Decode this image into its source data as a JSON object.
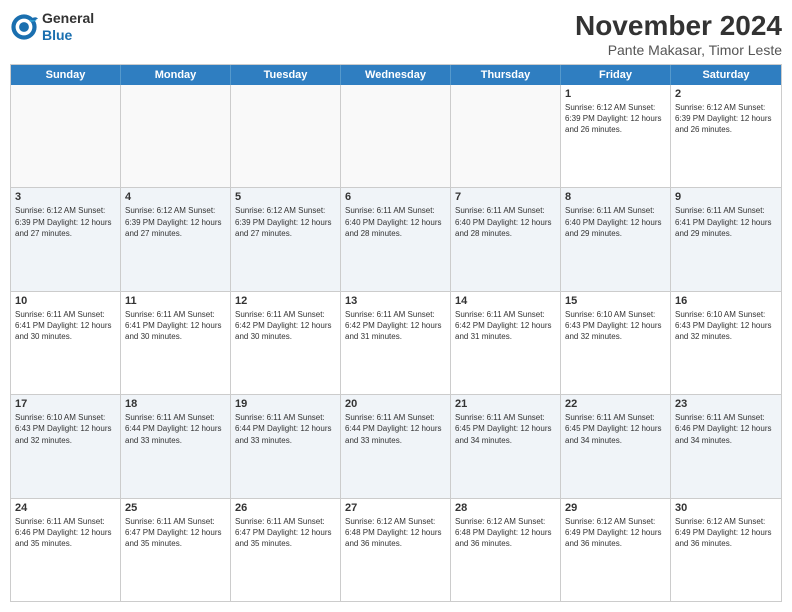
{
  "logo": {
    "text_general": "General",
    "text_blue": "Blue"
  },
  "title": "November 2024",
  "location": "Pante Makasar, Timor Leste",
  "days_of_week": [
    "Sunday",
    "Monday",
    "Tuesday",
    "Wednesday",
    "Thursday",
    "Friday",
    "Saturday"
  ],
  "weeks": [
    [
      {
        "date": "",
        "info": "",
        "empty": true
      },
      {
        "date": "",
        "info": "",
        "empty": true
      },
      {
        "date": "",
        "info": "",
        "empty": true
      },
      {
        "date": "",
        "info": "",
        "empty": true
      },
      {
        "date": "",
        "info": "",
        "empty": true
      },
      {
        "date": "1",
        "info": "Sunrise: 6:12 AM\nSunset: 6:39 PM\nDaylight: 12 hours and 26 minutes."
      },
      {
        "date": "2",
        "info": "Sunrise: 6:12 AM\nSunset: 6:39 PM\nDaylight: 12 hours and 26 minutes."
      }
    ],
    [
      {
        "date": "3",
        "info": "Sunrise: 6:12 AM\nSunset: 6:39 PM\nDaylight: 12 hours and 27 minutes."
      },
      {
        "date": "4",
        "info": "Sunrise: 6:12 AM\nSunset: 6:39 PM\nDaylight: 12 hours and 27 minutes."
      },
      {
        "date": "5",
        "info": "Sunrise: 6:12 AM\nSunset: 6:39 PM\nDaylight: 12 hours and 27 minutes."
      },
      {
        "date": "6",
        "info": "Sunrise: 6:11 AM\nSunset: 6:40 PM\nDaylight: 12 hours and 28 minutes."
      },
      {
        "date": "7",
        "info": "Sunrise: 6:11 AM\nSunset: 6:40 PM\nDaylight: 12 hours and 28 minutes."
      },
      {
        "date": "8",
        "info": "Sunrise: 6:11 AM\nSunset: 6:40 PM\nDaylight: 12 hours and 29 minutes."
      },
      {
        "date": "9",
        "info": "Sunrise: 6:11 AM\nSunset: 6:41 PM\nDaylight: 12 hours and 29 minutes."
      }
    ],
    [
      {
        "date": "10",
        "info": "Sunrise: 6:11 AM\nSunset: 6:41 PM\nDaylight: 12 hours and 30 minutes."
      },
      {
        "date": "11",
        "info": "Sunrise: 6:11 AM\nSunset: 6:41 PM\nDaylight: 12 hours and 30 minutes."
      },
      {
        "date": "12",
        "info": "Sunrise: 6:11 AM\nSunset: 6:42 PM\nDaylight: 12 hours and 30 minutes."
      },
      {
        "date": "13",
        "info": "Sunrise: 6:11 AM\nSunset: 6:42 PM\nDaylight: 12 hours and 31 minutes."
      },
      {
        "date": "14",
        "info": "Sunrise: 6:11 AM\nSunset: 6:42 PM\nDaylight: 12 hours and 31 minutes."
      },
      {
        "date": "15",
        "info": "Sunrise: 6:10 AM\nSunset: 6:43 PM\nDaylight: 12 hours and 32 minutes."
      },
      {
        "date": "16",
        "info": "Sunrise: 6:10 AM\nSunset: 6:43 PM\nDaylight: 12 hours and 32 minutes."
      }
    ],
    [
      {
        "date": "17",
        "info": "Sunrise: 6:10 AM\nSunset: 6:43 PM\nDaylight: 12 hours and 32 minutes."
      },
      {
        "date": "18",
        "info": "Sunrise: 6:11 AM\nSunset: 6:44 PM\nDaylight: 12 hours and 33 minutes."
      },
      {
        "date": "19",
        "info": "Sunrise: 6:11 AM\nSunset: 6:44 PM\nDaylight: 12 hours and 33 minutes."
      },
      {
        "date": "20",
        "info": "Sunrise: 6:11 AM\nSunset: 6:44 PM\nDaylight: 12 hours and 33 minutes."
      },
      {
        "date": "21",
        "info": "Sunrise: 6:11 AM\nSunset: 6:45 PM\nDaylight: 12 hours and 34 minutes."
      },
      {
        "date": "22",
        "info": "Sunrise: 6:11 AM\nSunset: 6:45 PM\nDaylight: 12 hours and 34 minutes."
      },
      {
        "date": "23",
        "info": "Sunrise: 6:11 AM\nSunset: 6:46 PM\nDaylight: 12 hours and 34 minutes."
      }
    ],
    [
      {
        "date": "24",
        "info": "Sunrise: 6:11 AM\nSunset: 6:46 PM\nDaylight: 12 hours and 35 minutes."
      },
      {
        "date": "25",
        "info": "Sunrise: 6:11 AM\nSunset: 6:47 PM\nDaylight: 12 hours and 35 minutes."
      },
      {
        "date": "26",
        "info": "Sunrise: 6:11 AM\nSunset: 6:47 PM\nDaylight: 12 hours and 35 minutes."
      },
      {
        "date": "27",
        "info": "Sunrise: 6:12 AM\nSunset: 6:48 PM\nDaylight: 12 hours and 36 minutes."
      },
      {
        "date": "28",
        "info": "Sunrise: 6:12 AM\nSunset: 6:48 PM\nDaylight: 12 hours and 36 minutes."
      },
      {
        "date": "29",
        "info": "Sunrise: 6:12 AM\nSunset: 6:49 PM\nDaylight: 12 hours and 36 minutes."
      },
      {
        "date": "30",
        "info": "Sunrise: 6:12 AM\nSunset: 6:49 PM\nDaylight: 12 hours and 36 minutes."
      }
    ]
  ]
}
